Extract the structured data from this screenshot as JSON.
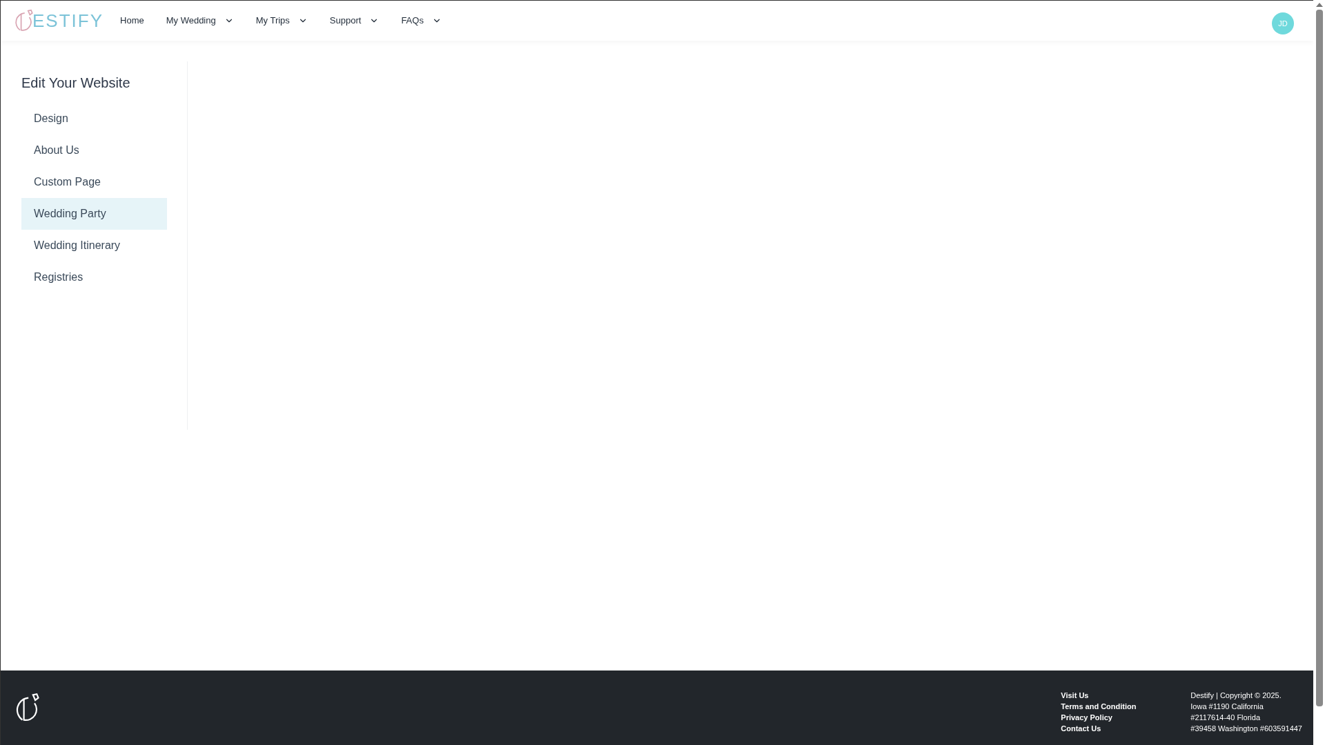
{
  "header": {
    "logo_text": "ESTIFY",
    "nav": [
      {
        "label": "Home",
        "dropdown": false
      },
      {
        "label": "My Wedding",
        "dropdown": true
      },
      {
        "label": "My Trips",
        "dropdown": true
      },
      {
        "label": "Support",
        "dropdown": true
      },
      {
        "label": "FAQs",
        "dropdown": true
      }
    ],
    "avatar": "JD"
  },
  "sidebar": {
    "title": "Edit Your Website",
    "items": [
      {
        "label": "Design",
        "selected": false
      },
      {
        "label": "About Us",
        "selected": false
      },
      {
        "label": "Custom Page",
        "selected": false
      },
      {
        "label": "Wedding Party",
        "selected": true
      },
      {
        "label": "Wedding Itinerary",
        "selected": false
      },
      {
        "label": "Registries",
        "selected": false
      }
    ]
  },
  "footer": {
    "links": [
      "Visit Us",
      "Terms and Condition",
      "Privacy Policy",
      "Contact Us"
    ],
    "info": [
      "Destify | Copyright © 2025.",
      "Iowa #1190 California",
      "#2117614-40 Florida",
      "#39458 Washington #603591447"
    ]
  }
}
